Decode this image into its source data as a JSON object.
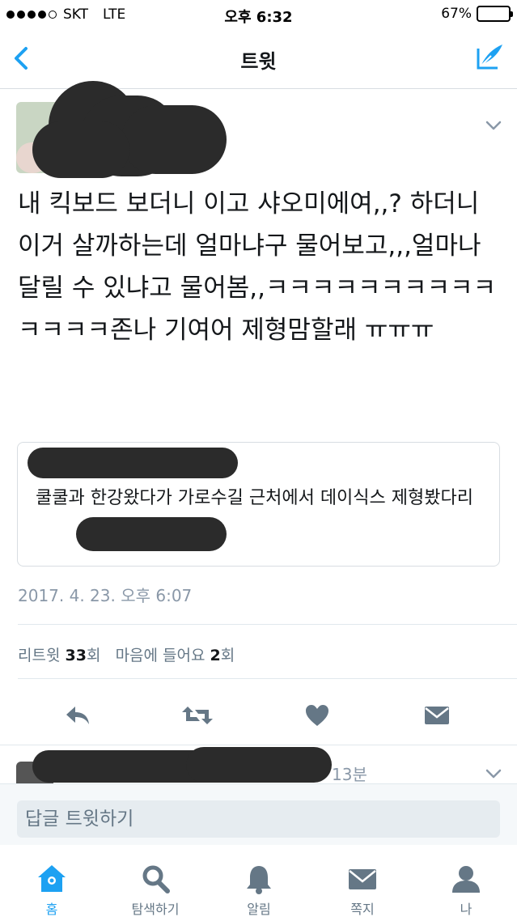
{
  "status_bar": {
    "carrier": "SKT",
    "network": "LTE",
    "time": "오후 6:32",
    "battery_text": "67%",
    "battery_level": 0.67,
    "signal_bars": 4
  },
  "nav": {
    "title": "트윗",
    "back_icon": "chevron-left-icon",
    "compose_icon": "compose-tweet-icon"
  },
  "tweet": {
    "text": "내 킥보드 보더니 이고 샤오미에여,,? 하더니 이거 살까하는데 얼마냐구 물어보고,,,얼마나 달릴 수 있냐고 물어봄,,ㅋㅋㅋㅋㅋㅋㅋㅋㅋㅋㅋㅋㅋㅋ존나 기여어 제형맘할래 ㅠㅠㅠ",
    "quote": {
      "text": "쿨쿨과 한강왔다가 가로수길 근처에서 데이식스 제형봤다리"
    },
    "timestamp": "2017. 4. 23. 오후 6:07",
    "stats": {
      "retweet_label": "리트윗",
      "retweet_count": "33",
      "retweet_unit": "회",
      "like_label": "마음에 들어요",
      "like_count": "2",
      "like_unit": "회"
    }
  },
  "reply_preview": {
    "time_ago": "13분"
  },
  "compose_reply": {
    "placeholder": "답글 트윗하기"
  },
  "tabs": [
    {
      "label": "홈",
      "icon": "home-icon",
      "active": true
    },
    {
      "label": "탐색하기",
      "icon": "search-icon",
      "active": false
    },
    {
      "label": "알림",
      "icon": "bell-icon",
      "active": false
    },
    {
      "label": "쪽지",
      "icon": "envelope-icon",
      "active": false
    },
    {
      "label": "나",
      "icon": "profile-icon",
      "active": false
    }
  ],
  "colors": {
    "accent": "#1da1f2",
    "icon_gray": "#657786",
    "text": "#14171a",
    "muted": "#8a98a8"
  }
}
